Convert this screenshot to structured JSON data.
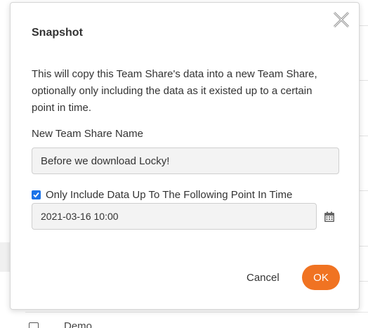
{
  "dialog": {
    "title": "Snapshot",
    "description": "This will copy this Team Share's data into a new Team Share, optionally only including the data as it existed up to a certain point in time.",
    "name_label": "New Team Share Name",
    "name_value": "Before we download Locky!",
    "include_checkbox": {
      "label": "Only Include Data Up To The Following Point In Time",
      "checked": true
    },
    "date_value": "2021-03-16 10:00",
    "cancel_label": "Cancel",
    "ok_label": "OK"
  },
  "background": {
    "row_label": "Demo"
  },
  "colors": {
    "accent_orange": "#f07322",
    "checkbox_blue": "#1a73e8"
  },
  "icons": {
    "close": "close-icon",
    "calendar": "calendar-icon",
    "check": "check-icon"
  }
}
